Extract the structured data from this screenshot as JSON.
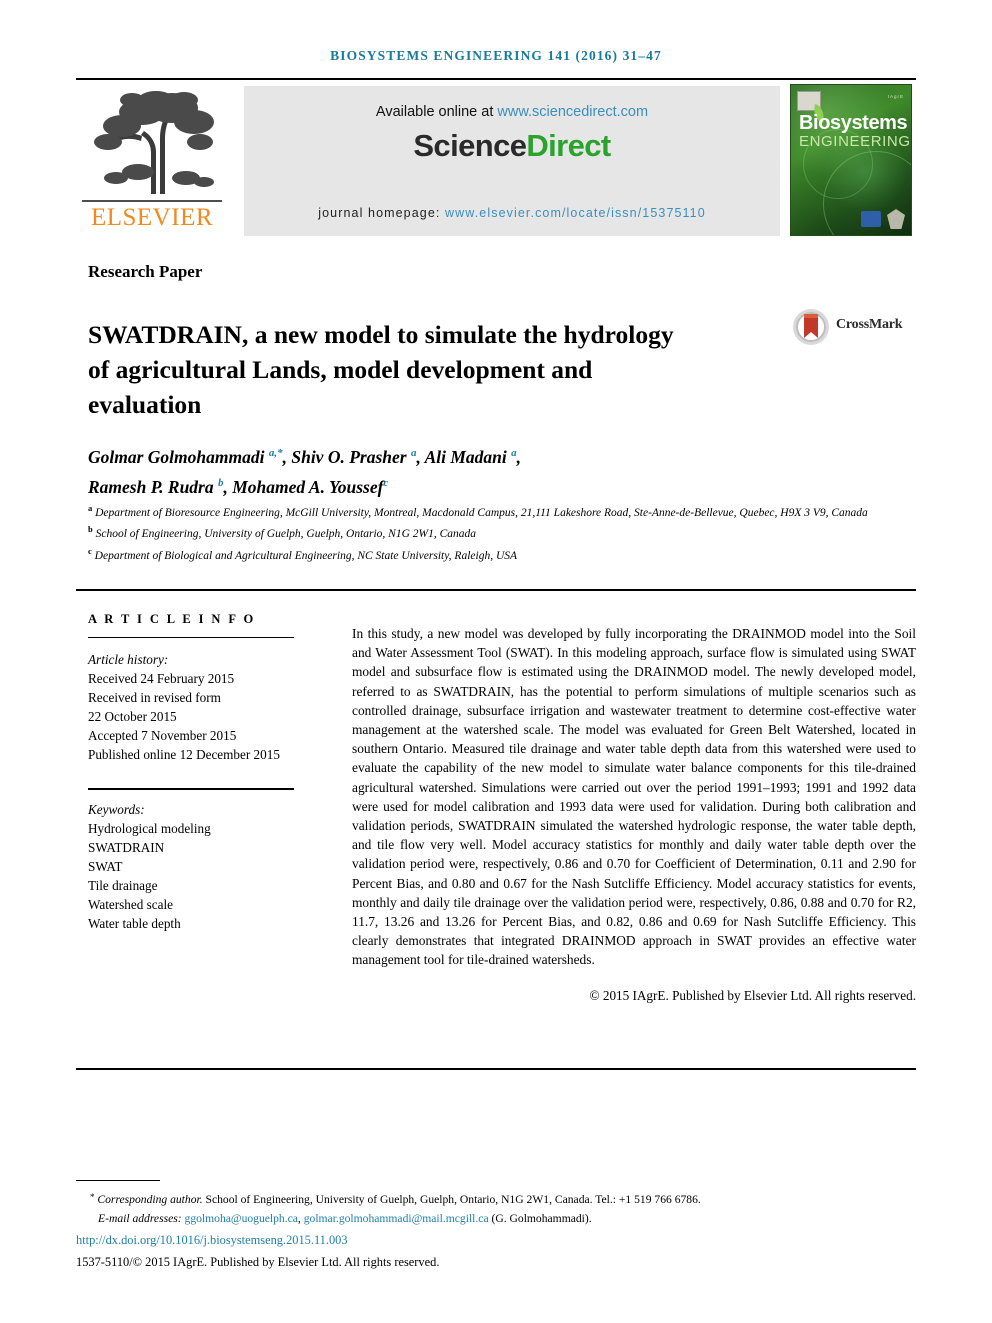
{
  "running_head": "BIOSYSTEMS ENGINEERING 141 (2016) 31–47",
  "masthead": {
    "publisher_name": "ELSEVIER",
    "available_prefix": "Available online at ",
    "available_url": "www.sciencedirect.com",
    "sciencedirect_part1": "Science",
    "sciencedirect_part2": "Direct",
    "homepage_label": "journal homepage: ",
    "homepage_url": "www.elsevier.com/locate/issn/15375110",
    "cover_title_line1": "Biosystems",
    "cover_title_line2": "ENGINEERING",
    "cover_corner_text": "IAgrE"
  },
  "article": {
    "section_type": "Research Paper",
    "title": "SWATDRAIN, a new model to simulate the hydrology of agricultural Lands, model development and evaluation",
    "crossmark_label": "CrossMark",
    "authors_line1_a": "Golmar Golmohammadi ",
    "authors_line1_a_sup": "a,*",
    "authors_line1_b": ", Shiv O. Prasher ",
    "authors_line1_b_sup": "a",
    "authors_line1_c": ", Ali Madani ",
    "authors_line1_c_sup": "a",
    "authors_line1_d": ",",
    "authors_line2_a": "Ramesh P. Rudra ",
    "authors_line2_a_sup": "b",
    "authors_line2_b": ", Mohamed A. Youssef",
    "authors_line2_b_sup": "c",
    "affiliations": [
      {
        "mark": "a",
        "text": "Department of Bioresource Engineering, McGill University, Montreal, Macdonald Campus, 21,111 Lakeshore Road, Ste-Anne-de-Bellevue, Quebec, H9X 3 V9, Canada"
      },
      {
        "mark": "b",
        "text": "School of Engineering, University of Guelph, Guelph, Ontario, N1G 2W1, Canada"
      },
      {
        "mark": "c",
        "text": "Department of Biological and Agricultural Engineering, NC State University, Raleigh, USA"
      }
    ]
  },
  "article_info": {
    "heading": "A R T I C L E  I N F O",
    "history_label": "Article history:",
    "history": [
      "Received 24 February 2015",
      "Received in revised form",
      "22 October 2015",
      "Accepted 7 November 2015",
      "Published online 12 December 2015"
    ],
    "keywords_label": "Keywords:",
    "keywords": [
      "Hydrological modeling",
      "SWATDRAIN",
      "SWAT",
      "Tile drainage",
      "Watershed scale",
      "Water table depth"
    ]
  },
  "abstract": {
    "body": "In this study, a new model was developed by fully incorporating the DRAINMOD model into the Soil and Water Assessment Tool (SWAT). In this modeling approach, surface flow is simulated using SWAT model and subsurface flow is estimated using the DRAINMOD model. The newly developed model, referred to as SWATDRAIN, has the potential to perform simulations of multiple scenarios such as controlled drainage, subsurface irrigation and wastewater treatment to determine cost-effective water management at the watershed scale. The model was evaluated for Green Belt Watershed, located in southern Ontario. Measured tile drainage and water table depth data from this watershed were used to evaluate the capability of the new model to simulate water balance components for this tile-drained agricultural watershed. Simulations were carried out over the period 1991–1993; 1991 and 1992 data were used for model calibration and 1993 data were used for validation. During both calibration and validation periods, SWATDRAIN simulated the watershed hydrologic response, the water table depth, and tile flow very well. Model accuracy statistics for monthly and daily water table depth over the validation period were, respectively, 0.86 and 0.70 for Coefficient of Determination, 0.11 and 2.90 for Percent Bias, and 0.80 and 0.67 for the Nash Sutcliffe Efficiency. Model accuracy statistics for events, monthly and daily tile drainage over the validation period were, respectively, 0.86, 0.88 and 0.70 for R2, 11.7, 13.26 and 13.26 for Percent Bias, and 0.82, 0.86 and 0.69 for Nash Sutcliffe Efficiency. This clearly demonstrates that integrated DRAINMOD approach in SWAT provides an effective water management tool for tile-drained watersheds.",
    "copyright": "© 2015 IAgrE. Published by Elsevier Ltd. All rights reserved."
  },
  "footnotes": {
    "corresponding_label": "Corresponding author.",
    "corresponding_text": " School of Engineering, University of Guelph, Guelph, Ontario, N1G 2W1, Canada. Tel.: +1 519 766 6786.",
    "email_label": "E-mail addresses:",
    "email1": "ggolmoha@uoguelph.ca",
    "email_sep": ", ",
    "email2": "golmar.golmohammadi@mail.mcgill.ca",
    "email_suffix": " (G. Golmohammadi).",
    "doi": "http://dx.doi.org/10.1016/j.biosystemseng.2015.11.003",
    "issn_line": "1537-5110/© 2015 IAgrE. Published by Elsevier Ltd. All rights reserved."
  },
  "colors": {
    "running_head": "#1a7a9e",
    "link": "#1f7fa8",
    "sciencedirect_green": "#2ba22b",
    "elsevier_orange": "#f08a1c",
    "masthead_grey": "#e6e6e6"
  }
}
